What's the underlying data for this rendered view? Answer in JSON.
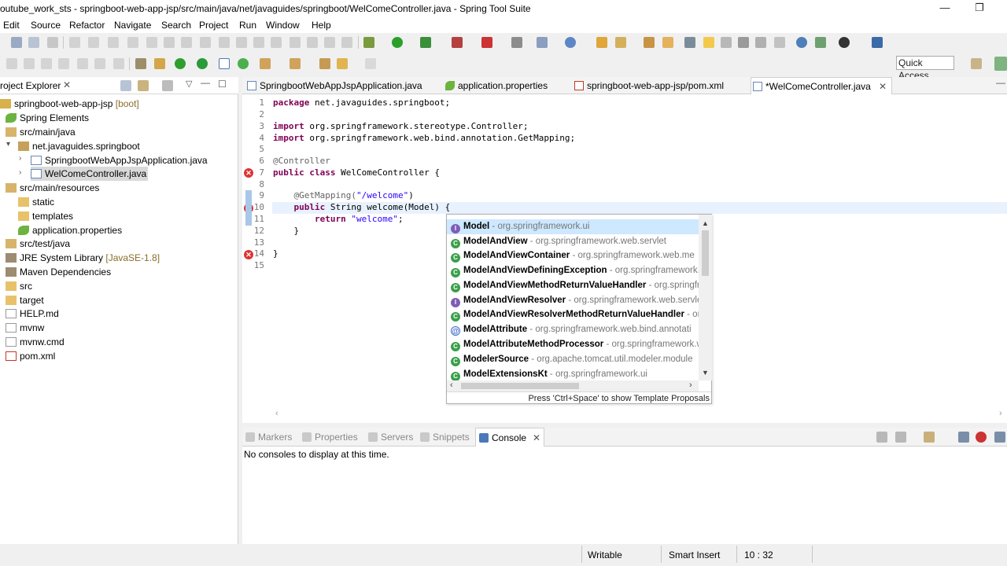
{
  "window": {
    "title": "outube_work_sts - springboot-web-app-jsp/src/main/java/net/javaguides/springboot/WelComeController.java - Spring Tool Suite",
    "minimize": "—",
    "restore": "❐"
  },
  "menu": [
    "Edit",
    "Source",
    "Refactor",
    "Navigate",
    "Search",
    "Project",
    "Run",
    "Window",
    "Help"
  ],
  "toolbar": {
    "quick_access": "Quick Access"
  },
  "project_explorer": {
    "title": "roject Explorer",
    "tree": [
      {
        "label": "springboot-web-app-jsp",
        "suffix": " [boot]",
        "icon": "project-icon"
      },
      {
        "label": "Spring Elements",
        "icon": "spring-leaf-icon"
      },
      {
        "label": "src/main/java",
        "icon": "source-folder-icon"
      },
      {
        "label": "net.javaguides.springboot",
        "icon": "package-icon"
      },
      {
        "label": "SpringbootWebAppJspApplication.java",
        "icon": "java-file-icon"
      },
      {
        "label": "WelComeController.java",
        "icon": "java-file-icon"
      },
      {
        "label": "src/main/resources",
        "icon": "source-folder-icon"
      },
      {
        "label": "static",
        "icon": "folder-icon"
      },
      {
        "label": "templates",
        "icon": "folder-icon"
      },
      {
        "label": "application.properties",
        "icon": "properties-file-icon"
      },
      {
        "label": "src/test/java",
        "icon": "source-folder-icon"
      },
      {
        "label": "JRE System Library",
        "suffix": " [JavaSE-1.8]",
        "icon": "library-icon"
      },
      {
        "label": "Maven Dependencies",
        "icon": "library-icon"
      },
      {
        "label": "src",
        "icon": "folder-icon"
      },
      {
        "label": "target",
        "icon": "folder-icon"
      },
      {
        "label": "HELP.md",
        "icon": "file-icon"
      },
      {
        "label": "mvnw",
        "icon": "file-icon"
      },
      {
        "label": "mvnw.cmd",
        "icon": "file-icon"
      },
      {
        "label": "pom.xml",
        "icon": "xml-file-icon"
      }
    ]
  },
  "editor_tabs": [
    {
      "label": "SpringbootWebAppJspApplication.java"
    },
    {
      "label": "application.properties"
    },
    {
      "label": "springboot-web-app-jsp/pom.xml"
    },
    {
      "label": "*WelComeController.java",
      "active": true
    }
  ],
  "code": {
    "line_numbers": [
      "1",
      "2",
      "3",
      "4",
      "5",
      "6",
      "7",
      "8",
      "9",
      "10",
      "11",
      "12",
      "13",
      "14",
      "15"
    ],
    "lines": [
      [
        "package",
        " net.javaguides.springboot;"
      ],
      [],
      [
        "import",
        " org.springframework.stereotype.Controller;"
      ],
      [
        "import",
        " org.springframework.web.bind.annotation.GetMapping;"
      ],
      [],
      [
        "@Controller"
      ],
      [
        "public",
        " ",
        "class",
        " WelComeController {"
      ],
      [],
      [
        "    ",
        "@GetMapping(",
        "\"/welcome\"",
        ")"
      ],
      [
        "    ",
        "public",
        " String welcome(Model) {"
      ],
      [
        "        ",
        "return",
        " ",
        "\"welcome\"",
        ";"
      ],
      [
        "    }"
      ],
      [],
      [
        "}"
      ],
      []
    ]
  },
  "completion": {
    "items": [
      {
        "name": "Model",
        "pkg": " - org.springframework.ui",
        "kind": "interface"
      },
      {
        "name": "ModelAndView",
        "pkg": " - org.springframework.web.servlet",
        "kind": "class"
      },
      {
        "name": "ModelAndViewContainer",
        "pkg": " - org.springframework.web.me",
        "kind": "class"
      },
      {
        "name": "ModelAndViewDefiningException",
        "pkg": " - org.springframework.",
        "kind": "class"
      },
      {
        "name": "ModelAndViewMethodReturnValueHandler",
        "pkg": " - org.springfr",
        "kind": "class"
      },
      {
        "name": "ModelAndViewResolver",
        "pkg": " - org.springframework.web.servle",
        "kind": "interface"
      },
      {
        "name": "ModelAndViewResolverMethodReturnValueHandler",
        "pkg": " - org",
        "kind": "class"
      },
      {
        "name": "ModelAttribute",
        "pkg": " - org.springframework.web.bind.annotati",
        "kind": "annotation"
      },
      {
        "name": "ModelAttributeMethodProcessor",
        "pkg": " - org.springframework.w",
        "kind": "class"
      },
      {
        "name": "ModelerSource",
        "pkg": " - org.apache.tomcat.util.modeler.module",
        "kind": "class"
      },
      {
        "name": "ModelExtensionsKt",
        "pkg": " - org.springframework.ui",
        "kind": "class"
      }
    ],
    "footer": "Press 'Ctrl+Space' to show Template Proposals"
  },
  "bottom_tabs": [
    "Markers",
    "Properties",
    "Servers",
    "Snippets",
    "Console"
  ],
  "console": {
    "message": "No consoles to display at this time."
  },
  "status": {
    "mode": "Writable",
    "insert": "Smart Insert",
    "position": "10 : 32"
  }
}
